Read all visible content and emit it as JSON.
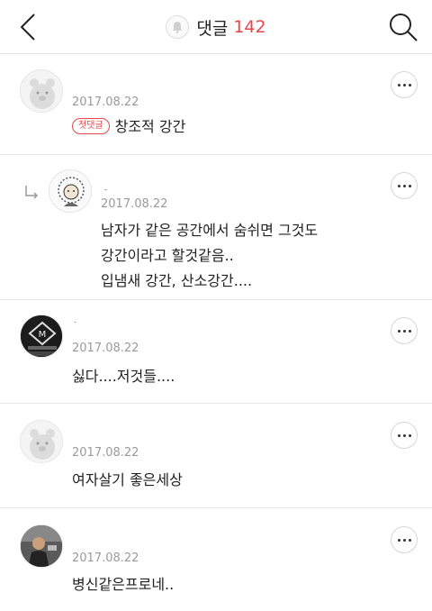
{
  "header": {
    "back_icon": "chevron-left-icon",
    "bell_icon": "bell-icon",
    "title": "댓글",
    "count": "142",
    "search_icon": "search-icon",
    "accent_color": "#e5474b"
  },
  "comments": [
    {
      "author": "",
      "date": "2017.08.22",
      "badge": "첫댓글",
      "text": "창조적 강간",
      "avatar": "bear-avatar"
    },
    {
      "author": "-",
      "date": "2017.08.22",
      "is_reply": true,
      "lines": [
        "남자가 같은 공간에서 숨쉬면 그것도",
        "강간이라고 할것같음..",
        "입냄새 강간, 산소강간...."
      ],
      "avatar": "sketch-avatar"
    },
    {
      "author": ".",
      "date": "2017.08.22",
      "text": "싫다....저것들....",
      "avatar": "maybach-logo-avatar"
    },
    {
      "author": "",
      "date": "2017.08.22",
      "text": "여자살기 좋은세상",
      "avatar": "bear-avatar"
    },
    {
      "author": "",
      "date": "2017.08.22",
      "text": "병신같은프로네..",
      "avatar": "photo-avatar"
    }
  ]
}
